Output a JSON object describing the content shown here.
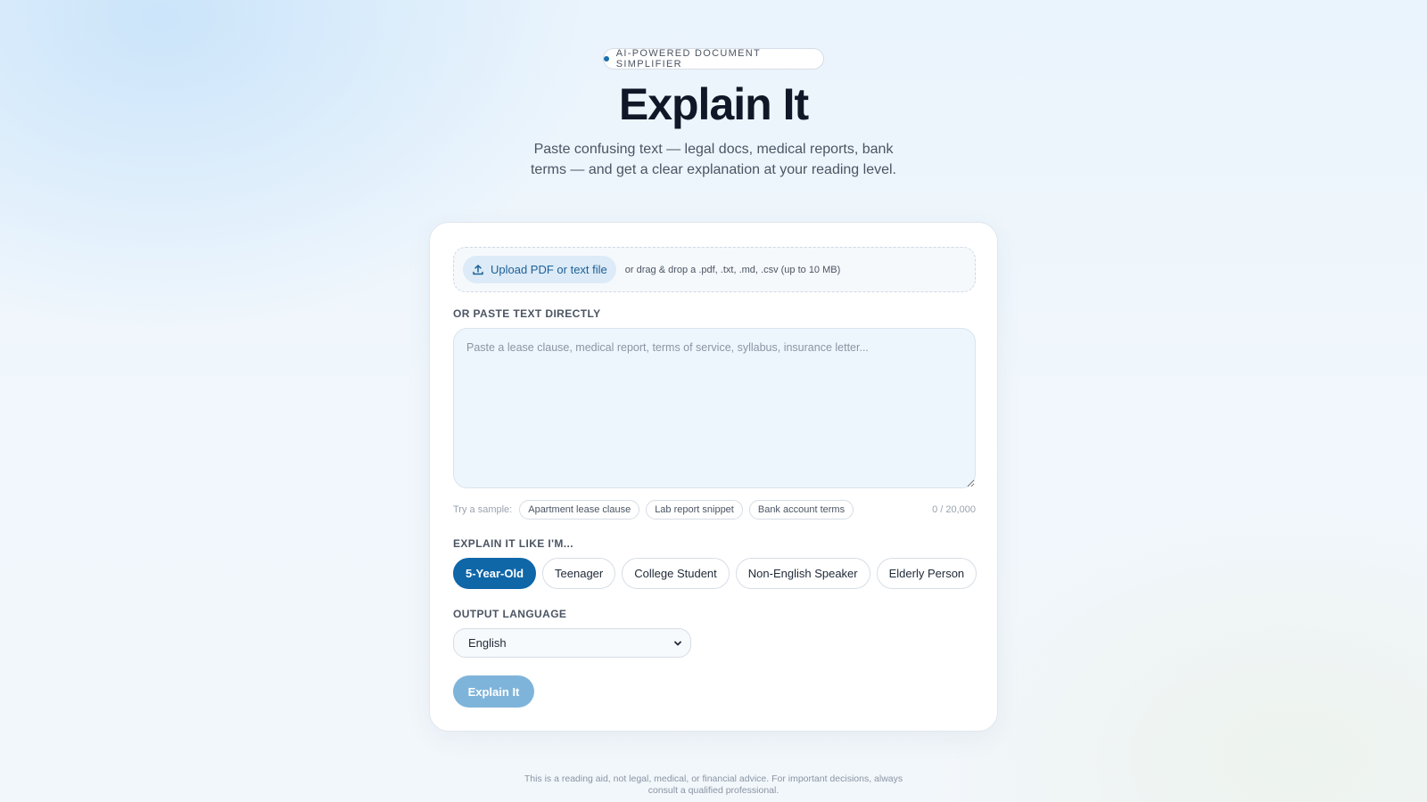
{
  "hero": {
    "badge": "AI-POWERED DOCUMENT SIMPLIFIER",
    "title": "Explain It",
    "subtitle": "Paste confusing text — legal docs, medical reports, bank terms — and get a clear explanation at your reading level."
  },
  "upload": {
    "button_label": "Upload PDF or text file",
    "hint": "or drag & drop a .pdf, .txt, .md, .csv (up to 10 MB)"
  },
  "paste": {
    "label": "OR PASTE TEXT DIRECTLY",
    "placeholder": "Paste a lease clause, medical report, terms of service, syllabus, insurance letter...",
    "value": ""
  },
  "samples": {
    "label": "Try a sample:",
    "items": [
      "Apartment lease clause",
      "Lab report snippet",
      "Bank account terms"
    ],
    "char_count": "0 / 20,000"
  },
  "levels": {
    "label": "EXPLAIN IT LIKE I'M...",
    "options": [
      "5-Year-Old",
      "Teenager",
      "College Student",
      "Non-English Speaker",
      "Elderly Person"
    ],
    "selected": "5-Year-Old"
  },
  "language": {
    "label": "OUTPUT LANGUAGE",
    "selected": "English"
  },
  "submit": {
    "label": "Explain It"
  },
  "footer": {
    "disclaimer": "This is a reading aid, not legal, medical, or financial advice. For important decisions, always consult a qualified professional."
  },
  "colors": {
    "accent": "#0f67a8",
    "accent_disabled": "#7fb4da",
    "badge_dot": "#1d6fb0"
  },
  "icons": {
    "upload": "upload-icon",
    "select_chevron": "chevron-down-icon"
  }
}
